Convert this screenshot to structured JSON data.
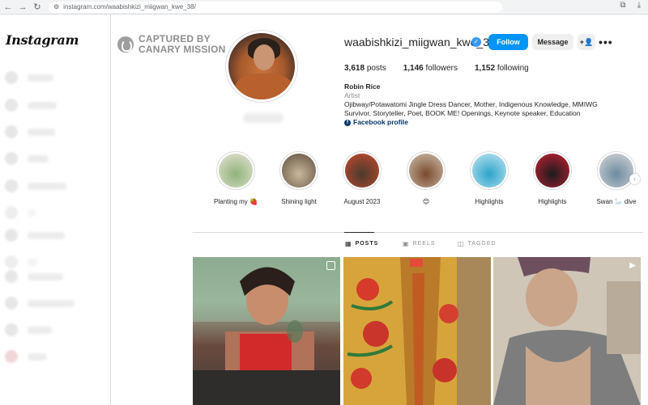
{
  "browser": {
    "url": "instagram.com/waabishkizi_miigwan_kwe_38/",
    "back_icon": "←",
    "forward_icon": "→",
    "reload_icon": "↻",
    "site_info_icon": "⚙"
  },
  "sidebar": {
    "logo": "Instagram"
  },
  "watermark": {
    "line1": "CAPTURED BY",
    "line2": "CANARY MISSION"
  },
  "profile": {
    "username": "waabishkizi_miigwan_kwe_38",
    "verified_icon": "✓",
    "follow_label": "Follow",
    "message_label": "Message",
    "add_user_icon": "+👤",
    "more_icon": "•••",
    "stats": {
      "posts_count": "3,618",
      "posts_label": "posts",
      "followers_count": "1,146",
      "followers_label": "followers",
      "following_count": "1,152",
      "following_label": "following"
    },
    "bio": {
      "name": "Robin Rice",
      "category": "Artist",
      "text": "Ojibway/Potawatomi Jingle Dress Dancer, Mother, Indigenous Knowledge, MMIWG Survivor, Storyteller, Poet, BOOK ME! Openings, Keynote speaker, Education",
      "link_label": "Facebook profile",
      "link_icon": "f"
    }
  },
  "highlights": [
    {
      "label": "Planting my 🍓",
      "colors": [
        "#8fb37a",
        "#e9e4d8"
      ]
    },
    {
      "label": "Shining light",
      "colors": [
        "#c9b89c",
        "#5d4b3a"
      ]
    },
    {
      "label": "August 2023",
      "colors": [
        "#4a3b2c",
        "#c74a2f"
      ]
    },
    {
      "label": "😊",
      "colors": [
        "#7a4a2e",
        "#d1c2b0"
      ]
    },
    {
      "label": "Highlights",
      "colors": [
        "#2aa3c9",
        "#c8e8f3"
      ]
    },
    {
      "label": "Highlights",
      "colors": [
        "#1c1c1c",
        "#c62035"
      ]
    },
    {
      "label": "Swan 🦢 dive",
      "colors": [
        "#6b8aa0",
        "#d9d9d9"
      ]
    }
  ],
  "highlights_next_icon": "›",
  "tabs": [
    {
      "label": "POSTS",
      "icon": "▦"
    },
    {
      "label": "REELS",
      "icon": "▣"
    },
    {
      "label": "TAGGED",
      "icon": "◫"
    }
  ],
  "posts": {
    "reel_icon": "▶"
  }
}
